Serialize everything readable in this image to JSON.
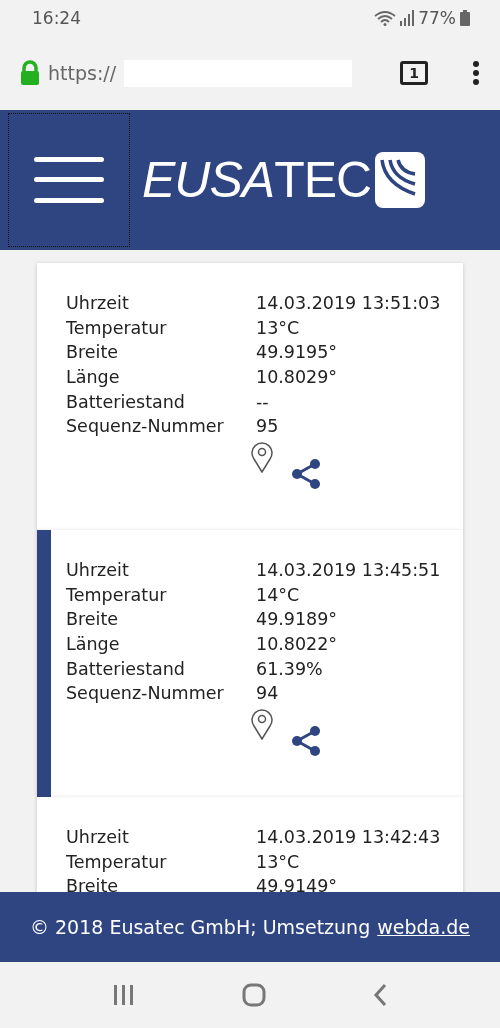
{
  "status_bar": {
    "time": "16:24",
    "battery": "77%"
  },
  "browser": {
    "url": "https://",
    "tab_count": "1"
  },
  "header": {
    "logo_slanted": "EUSA",
    "logo_upright": "TEC"
  },
  "records": [
    {
      "selected": false,
      "fields": [
        {
          "label": "Uhrzeit",
          "value": "14.03.2019 13:51:03"
        },
        {
          "label": "Temperatur",
          "value": "13°C"
        },
        {
          "label": "Breite",
          "value": "49.9195°"
        },
        {
          "label": "Länge",
          "value": "10.8029°"
        },
        {
          "label": "Batteriestand",
          "value": "--"
        },
        {
          "label": "Sequenz-Nummer",
          "value": "95"
        }
      ]
    },
    {
      "selected": true,
      "fields": [
        {
          "label": "Uhrzeit",
          "value": "14.03.2019 13:45:51"
        },
        {
          "label": "Temperatur",
          "value": "14°C"
        },
        {
          "label": "Breite",
          "value": "49.9189°"
        },
        {
          "label": "Länge",
          "value": "10.8022°"
        },
        {
          "label": "Batteriestand",
          "value": "61.39%"
        },
        {
          "label": "Sequenz-Nummer",
          "value": "94"
        }
      ]
    },
    {
      "selected": false,
      "fields": [
        {
          "label": "Uhrzeit",
          "value": "14.03.2019 13:42:43"
        },
        {
          "label": "Temperatur",
          "value": "13°C"
        },
        {
          "label": "Breite",
          "value": "49.9149°"
        }
      ]
    }
  ],
  "footer": {
    "text": "© 2018 Eusatec GmbH; Umsetzung",
    "link": "webda.de"
  }
}
